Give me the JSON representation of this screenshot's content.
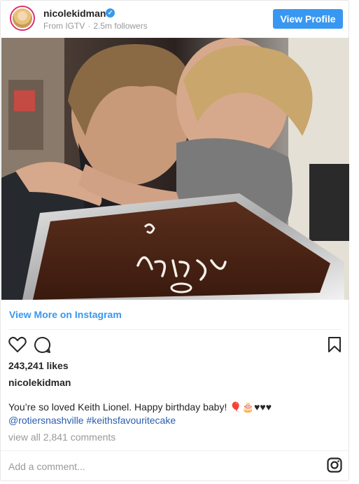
{
  "header": {
    "username": "nicolekidman",
    "verified_icon": "verified-check-icon",
    "source": "From IGTV",
    "followers": "2.5m followers",
    "view_profile_label": "View Profile"
  },
  "photo": {
    "cake_text": "hday",
    "subject": "photo-of-couple-with-birthday-cake"
  },
  "view_more_label": "View More on Instagram",
  "actions": {
    "like_icon": "heart-icon",
    "comment_icon": "comment-icon",
    "save_icon": "bookmark-icon"
  },
  "likes": "243,241 likes",
  "author": "nicolekidman",
  "caption": "You’re so loved Keith Lionel. Happy birthday baby! 🎈🎂♥♥♥",
  "mentions": "@rotiersnashville #keithsfavouritecake",
  "comments_label": "view all 2,841 comments",
  "add_comment_placeholder": "Add a comment...",
  "instagram_icon": "instagram-icon",
  "colors": {
    "accent": "#3897f0",
    "text": "#262626",
    "muted": "#999999",
    "link": "#2a5db0"
  }
}
